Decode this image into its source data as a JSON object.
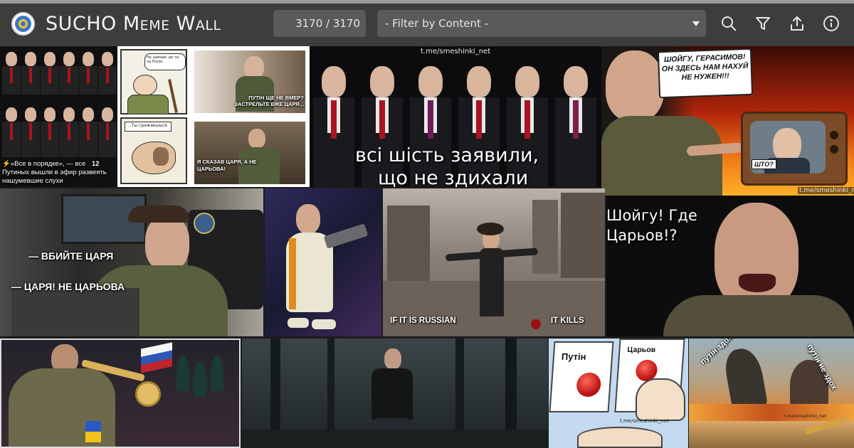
{
  "header": {
    "app_title": "SUCHO Meme Wall",
    "counter": "3170 / 3170",
    "filter_placeholder": "- Filter by Content -",
    "icons": [
      "logo",
      "search-icon",
      "filter-icon",
      "share-icon",
      "info-icon"
    ]
  },
  "memes": {
    "putin_grid": {
      "caption_line1": "«Все в порядке», — все",
      "caption_count": "12",
      "caption_line2": "Путиных вышли в эфир развеять",
      "caption_line3": "нашумевшие слухи"
    },
    "budanov_comic": {
      "panel1_bubble": "Не займай, де ти на Росію.",
      "panel2_caption": "ПУТІН ЩЕ НЕ ВМЕР? ЗАСТРЕЛЬТЕ ВЖЕ ЦАРЯ...",
      "panel3_bubble": "...Ты сражаешься.",
      "panel4_caption": "Я СКАЗАВ ЦАРЯ, А НЕ ЦАРЬОВА!"
    },
    "six_putins": {
      "watermark": "t.me/smeshinki_net",
      "caption_line1": "всі шість заявили,",
      "caption_line2": "що не здихали"
    },
    "prigozhin_tv": {
      "bubble": "ШОЙГУ, ГЕРАСИМОВ! ОН ЗДЕСЬ НАМ НАХУЙ НЕ НУЖЕН!!!",
      "tv_label": "ШТО?",
      "watermark": "t.me/smeshinki_net"
    },
    "budanov_office": {
      "line1": "— ВБИЙТЕ ЦАРЯ",
      "line2": "— ЦАРЯ! НЕ ЦАРЬОВА"
    },
    "poet_ruins": {
      "left": "IF IT IS RUSSIAN",
      "right": "IT KILLS"
    },
    "prigozhin_shout": {
      "caption": "Шойгу! Где Царьов!?"
    },
    "buttons": {
      "left": "Путін",
      "right": "Царьов",
      "watermark": "t.me/smeshinki_net"
    },
    "godzilla": {
      "left": "путін здох",
      "right": "путін не здох",
      "watermark": "t.me/smeshinki_net"
    }
  },
  "colors": {
    "header_bg": "#3d3d3d",
    "field_bg": "#5a5a5a",
    "page_bg": "#1b1b1b",
    "accent_red": "#c11717"
  }
}
